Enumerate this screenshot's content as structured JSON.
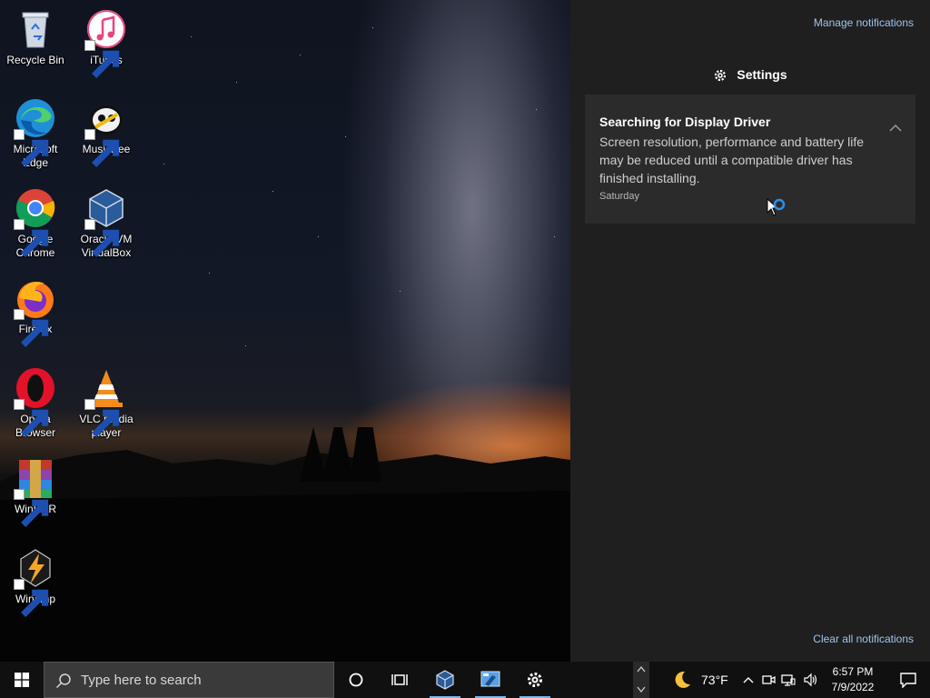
{
  "desktop": {
    "icons": [
      {
        "label": "Recycle Bin",
        "icon": "recycle-bin-icon"
      },
      {
        "label": "iTunes",
        "icon": "itunes-icon"
      },
      {
        "label": "Microsoft Edge",
        "icon": "edge-icon"
      },
      {
        "label": "MusicBee",
        "icon": "musicbee-icon"
      },
      {
        "label": "Google Chrome",
        "icon": "chrome-icon"
      },
      {
        "label": "Oracle VM VirtualBox",
        "icon": "virtualbox-icon"
      },
      {
        "label": "Firefox",
        "icon": "firefox-icon"
      },
      {
        "label": "Opera Browser",
        "icon": "opera-icon"
      },
      {
        "label": "VLC media player",
        "icon": "vlc-icon"
      },
      {
        "label": "WinRAR",
        "icon": "winrar-icon"
      },
      {
        "label": "Winamp",
        "icon": "winamp-icon"
      }
    ]
  },
  "action_center": {
    "manage_notifications": "Manage notifications",
    "group_title": "Settings",
    "notification": {
      "title": "Searching for Display Driver",
      "body": "Screen resolution, performance and battery life may be reduced until a compatible driver has finished installing.",
      "time": "Saturday"
    },
    "clear_all": "Clear all notifications"
  },
  "taskbar": {
    "search_placeholder": "Type here to search",
    "weather_temp": "73°F",
    "clock_time": "6:57 PM",
    "clock_date": "7/9/2022"
  },
  "colors": {
    "accent_link": "#9fc4ee",
    "taskbar_indicator": "#76b9ed",
    "panel_bg": "#1f1f1f",
    "card_bg": "#2b2b2b"
  }
}
